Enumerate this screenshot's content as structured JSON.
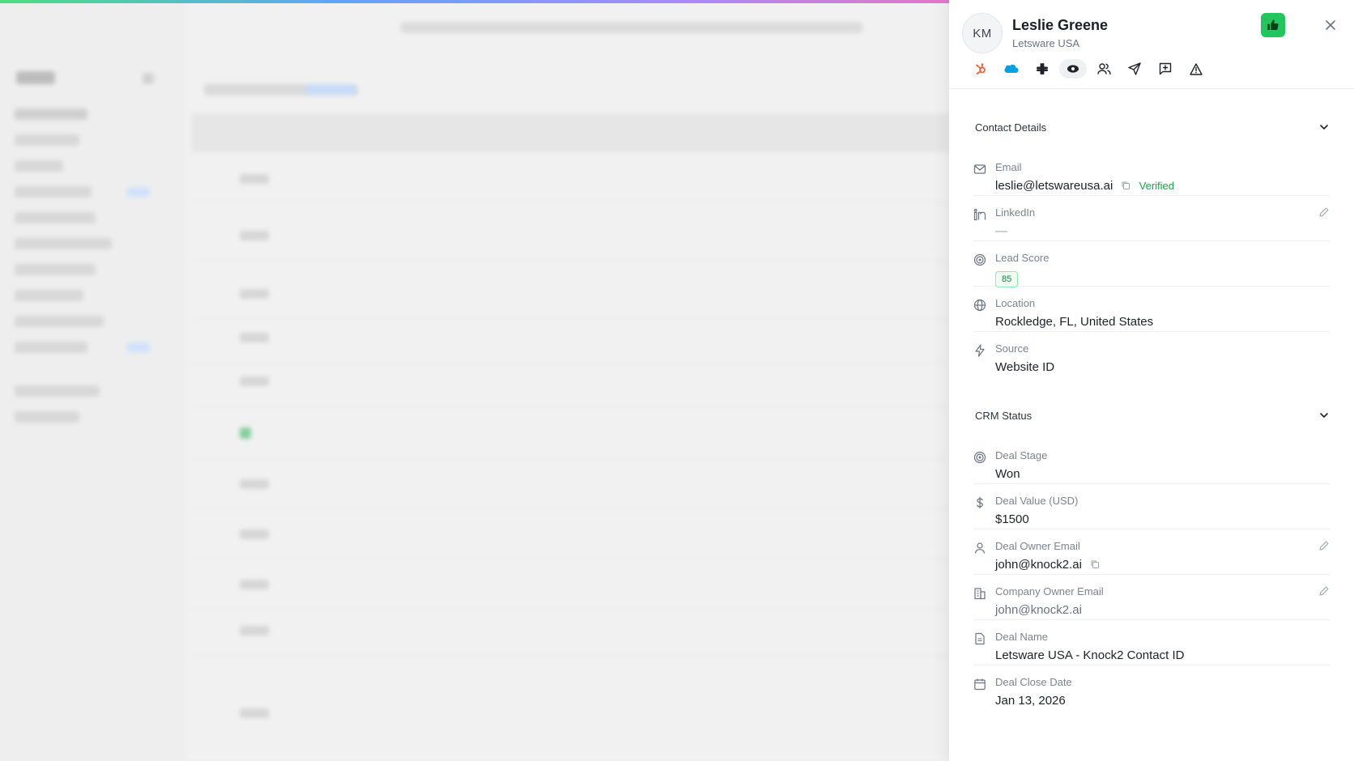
{
  "contact": {
    "initials": "KM",
    "name": "Leslie Greene",
    "company": "Letsware USA"
  },
  "toolbar": {
    "icons": [
      "hubspot-icon",
      "salesforce-icon",
      "slack-icon",
      "eye-icon",
      "users-icon",
      "send-icon",
      "message-plus-icon",
      "warning-icon"
    ]
  },
  "contact_details": {
    "title": "Contact Details",
    "email_label": "Email",
    "email_value": "leslie@letswareusa.ai",
    "email_status": "Verified",
    "linkedin_label": "LinkedIn",
    "linkedin_value": "—",
    "lead_score_label": "Lead Score",
    "lead_score_value": "85",
    "location_label": "Location",
    "location_value": "Rockledge, FL, United States",
    "source_label": "Source",
    "source_value": "Website ID"
  },
  "crm_status": {
    "title": "CRM Status",
    "deal_stage_label": "Deal Stage",
    "deal_stage_value": "Won",
    "deal_value_label": "Deal Value (USD)",
    "deal_value_value": "$1500",
    "deal_owner_label": "Deal Owner Email",
    "deal_owner_value": "john@knock2.ai",
    "company_owner_label": "Company Owner Email",
    "company_owner_value": "john@knock2.ai",
    "deal_name_label": "Deal Name",
    "deal_name_value": "Letsware USA - Knock2 Contact ID",
    "deal_close_label": "Deal Close Date",
    "deal_close_value": "Jan 13, 2026"
  },
  "colors": {
    "accent_green": "#22c55e",
    "verified_green": "#16a34a",
    "hubspot_orange": "#ff5c35",
    "salesforce_blue": "#00a1e0"
  }
}
